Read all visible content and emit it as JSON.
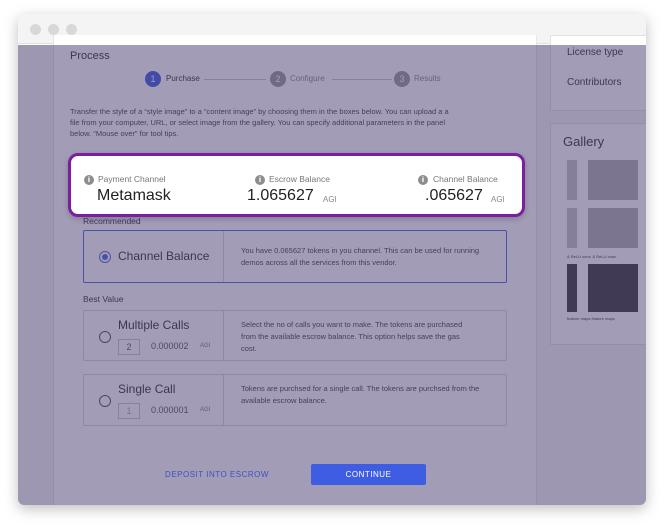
{
  "process": {
    "title": "Process",
    "steps": [
      {
        "number": "1",
        "label": "Purchase"
      },
      {
        "number": "2",
        "label": "Configure"
      },
      {
        "number": "3",
        "label": "Results"
      }
    ],
    "description_line1": "Transfer the style of a “style image” to a “content image” by choosing them in the boxes below.  You can upload a a",
    "description_line2": "file from your computer, URL, or select image from the gallery.  You can specify additional parameters in the panel",
    "description_line3": "below.  “Mouse over” for tool tips."
  },
  "balances": {
    "payment_channel_label": "Payment Channel",
    "payment_channel_value": "Metamask",
    "escrow_label": "Escrow Balance",
    "escrow_value": "1.065627",
    "escrow_unit": "AGI",
    "channel_label": "Channel Balance",
    "channel_value": ".065627",
    "channel_unit": "AGI"
  },
  "recommended": {
    "section_label": "Recommended",
    "option_label": "Channel Balance",
    "description_line1": "You have 0.065627 tokens in you channel. This can be used for running",
    "description_line2": "demos across all the services from this vendor."
  },
  "best_value": {
    "section_label": "Best Value",
    "multiple": {
      "label": "Multiple Calls",
      "quantity": "2",
      "price": "0.000002",
      "unit": "AGI",
      "description_line1": "Select the no of calls you want to make. The tokens are purchased",
      "description_line2": "from the available escrow balance. This  option helps save the gas",
      "description_line3": "cost."
    },
    "single": {
      "label": "Single Call",
      "quantity": "1",
      "price": "0.000001",
      "unit": "AGI",
      "description_line1": "Tokens are purchsed for a single call. The tokens are purchsed from the",
      "description_line2": "available escrow balance."
    }
  },
  "actions": {
    "deposit": "DEPOSIT INTO ESCROW",
    "continue": "CONTINUE"
  },
  "sidebar": {
    "license_label": "License type",
    "contributors_label": "Contributors",
    "gallery_title": "Gallery",
    "gallery_caption_1": "& ReLU  conv. & ReLU   conv.",
    "gallery_caption_2": "feature maps    feature maps"
  },
  "colors": {
    "accent": "#3f5de3",
    "highlight_border": "#7a1fa2",
    "overlay": "#463a6e"
  }
}
